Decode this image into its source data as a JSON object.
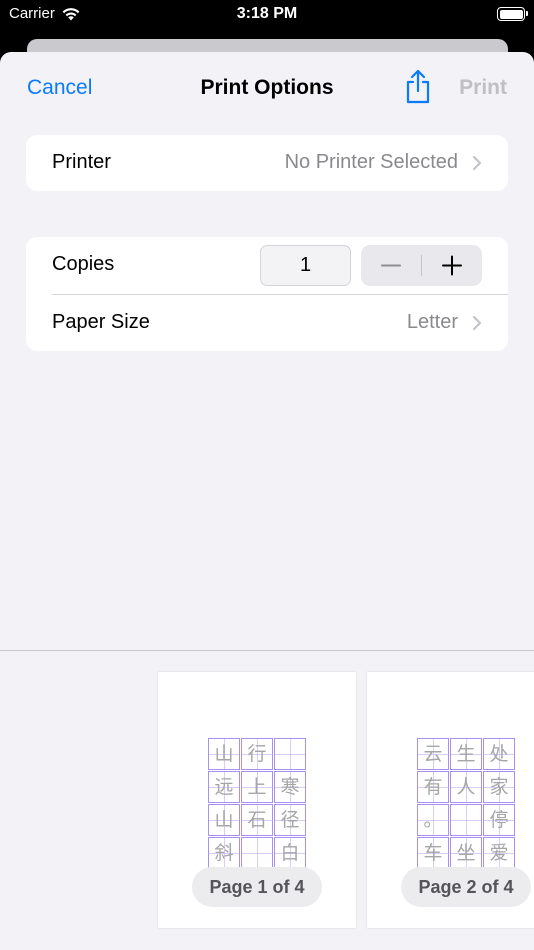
{
  "status_bar": {
    "carrier": "Carrier",
    "time": "3:18 PM",
    "wifi_icon": "wifi-icon",
    "battery_icon": "battery-full-icon"
  },
  "nav": {
    "cancel_label": "Cancel",
    "title": "Print Options",
    "share_icon": "share-icon",
    "print_label": "Print"
  },
  "printer_row": {
    "label": "Printer",
    "value": "No Printer Selected"
  },
  "copies_row": {
    "label": "Copies",
    "value": "1",
    "minus_icon": "minus-icon",
    "plus_icon": "plus-icon"
  },
  "paper_row": {
    "label": "Paper Size",
    "value": "Letter"
  },
  "previews": [
    {
      "label": "Page 1 of 4",
      "characters": [
        "山",
        "行",
        "",
        "远",
        "上",
        "寒",
        "山",
        "石",
        "径",
        "斜",
        "",
        "白"
      ]
    },
    {
      "label": "Page 2 of 4",
      "characters": [
        "云",
        "生",
        "处",
        "有",
        "人",
        "家",
        "。",
        "",
        "停",
        "车",
        "坐",
        "爱"
      ]
    }
  ],
  "colors": {
    "accent": "#0a7aff",
    "disabled": "#bfbfc4",
    "secondary_text": "#8a8a8e",
    "grid_purple": "#a98ff0",
    "background": "#f2f2f7"
  }
}
